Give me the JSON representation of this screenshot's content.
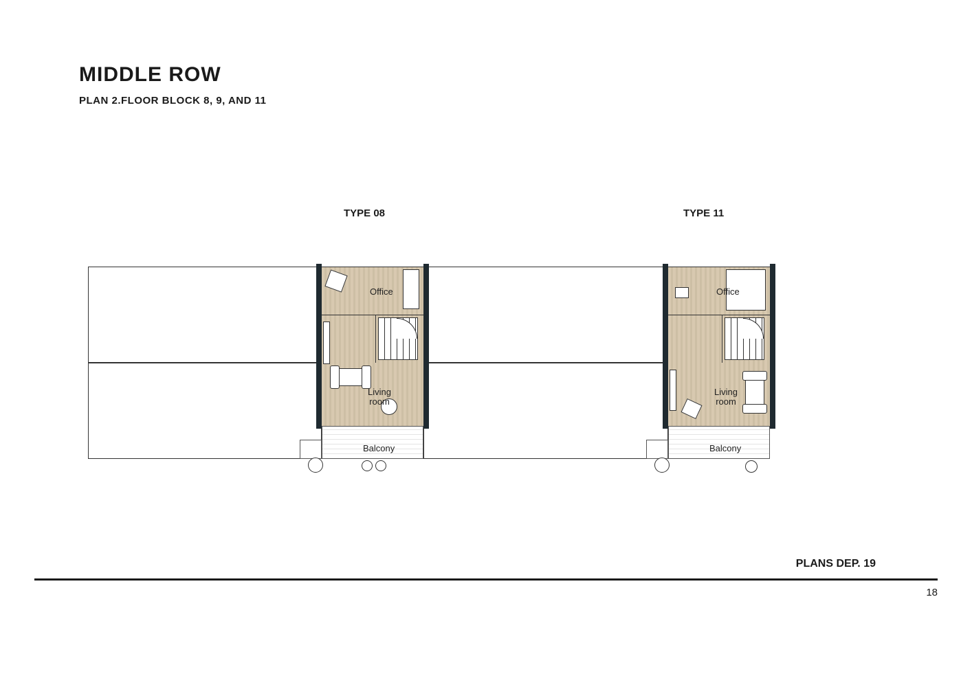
{
  "header": {
    "title": "MIDDLE ROW",
    "subtitle": "PLAN 2.FLOOR BLOCK 8, 9, AND 11"
  },
  "types": {
    "left": "TYPE 08",
    "right": "TYPE 11"
  },
  "rooms": {
    "office": "Office",
    "living1": "Living",
    "living2": "room",
    "balcony": "Balcony"
  },
  "footer": {
    "label": "PLANS DEP. 19",
    "page": "18"
  }
}
